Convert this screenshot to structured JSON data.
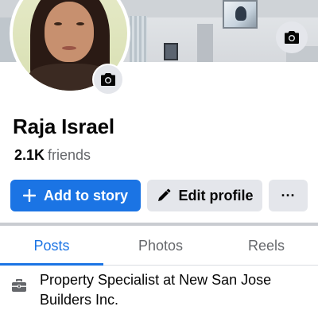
{
  "profile": {
    "name": "Raja Israel",
    "friends_count": "2.1K",
    "friends_label": "friends"
  },
  "actions": {
    "add_to_story": "Add to story",
    "add_icon": "plus-icon",
    "edit_profile": "Edit profile",
    "edit_icon": "pencil-icon",
    "more": "···"
  },
  "tabs": [
    {
      "label": "Posts",
      "active": true
    },
    {
      "label": "Photos",
      "active": false
    },
    {
      "label": "Reels",
      "active": false
    }
  ],
  "intro": {
    "work": "Property Specialist at New San Jose Builders Inc.",
    "work_icon": "briefcase-icon"
  },
  "colors": {
    "primary": "#1b74e4",
    "secondary_button": "#e4e6eb",
    "muted_text": "#65676b"
  }
}
